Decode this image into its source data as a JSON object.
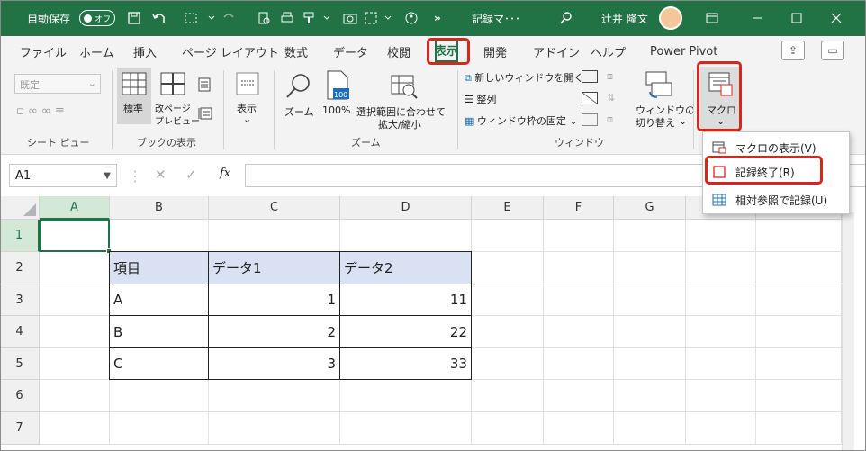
{
  "titlebar": {
    "autosave": "自動保存",
    "toggle": "オフ",
    "filename": "記録マ･･･",
    "chevron": "›",
    "user": "辻井 隆文",
    "more": "»"
  },
  "tabs": [
    {
      "label": "ファイル"
    },
    {
      "label": "ホーム"
    },
    {
      "label": "挿入"
    },
    {
      "label": "ページ レイアウト"
    },
    {
      "label": "数式"
    },
    {
      "label": "データ"
    },
    {
      "label": "校閲"
    },
    {
      "label": "表示"
    },
    {
      "label": "開発"
    },
    {
      "label": "アドイン"
    },
    {
      "label": "ヘルプ"
    },
    {
      "label": "Power Pivot"
    }
  ],
  "ribbon": {
    "sheetview": {
      "dropdown": "既定",
      "label": "シート ビュー"
    },
    "bookview": {
      "normal": "標準",
      "pagebreak_l1": "改ページ",
      "pagebreak_l2": "プレビュー",
      "label": "ブックの表示"
    },
    "show": {
      "label": "表示"
    },
    "zoom": {
      "zoom": "ズーム",
      "hundred": "100%",
      "sel_l1": "選択範囲に合わせて",
      "sel_l2": "拡大/縮小",
      "label": "ズーム",
      "badge": "100"
    },
    "window": {
      "newwin": "新しいウィンドウを開く",
      "arrange": "整列",
      "freeze": "ウィンドウ枠の固定",
      "switch_l1": "ウィンドウの",
      "switch_l2": "切り替え",
      "label": "ウィンドウ"
    },
    "macro": {
      "label": "マクロ"
    }
  },
  "menu": {
    "items": [
      {
        "label": "マクロの表示(V)"
      },
      {
        "label": "記録終了(R)"
      },
      {
        "label": "相対参照で記録(U)"
      }
    ]
  },
  "formula": {
    "namebox": "A1",
    "fx": "fx"
  },
  "sheet": {
    "columns": [
      "A",
      "B",
      "C",
      "D",
      "E",
      "F",
      "G"
    ],
    "rows": [
      "1",
      "2",
      "3",
      "4",
      "5",
      "6",
      "7"
    ],
    "table": {
      "header": [
        "項目",
        "データ1",
        "データ2"
      ],
      "rows": [
        [
          "A",
          "1",
          "11"
        ],
        [
          "B",
          "2",
          "22"
        ],
        [
          "C",
          "3",
          "33"
        ]
      ]
    }
  },
  "colors": {
    "excel_green": "#217346",
    "highlight_red": "#d9261c",
    "table_header": "#d9e1f2"
  }
}
